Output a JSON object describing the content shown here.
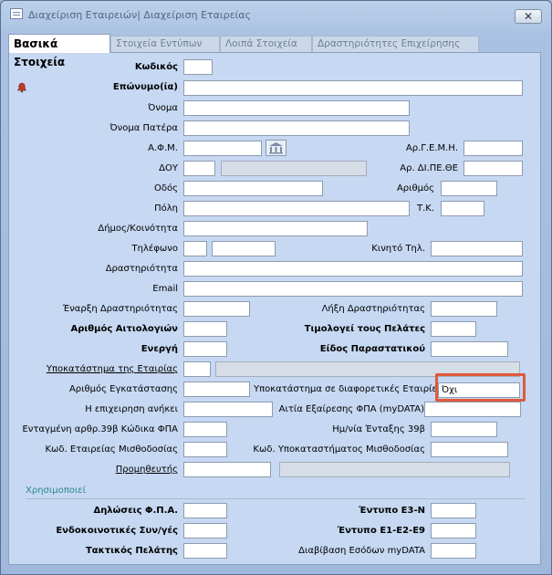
{
  "window": {
    "title": "Διαχείριση Εταιρειών| Διαχείριση Εταιρείας",
    "close_label": "✕"
  },
  "tabs": [
    {
      "label": "Βασικά Στοιχεία"
    },
    {
      "label": "Στοιχεία Εντύπων"
    },
    {
      "label": "Λοιπά Στοιχεία"
    },
    {
      "label": "Δραστηριότητες Επιχείρησης"
    }
  ],
  "labels": {
    "code": "Κωδικός",
    "surname": "Επώνυμο(ία)",
    "name": "Όνομα",
    "father": "Όνομα Πατέρα",
    "afm": "Α.Φ.Μ.",
    "gemi": "Αρ.Γ.Ε.Μ.Η.",
    "doy": "ΔΟΥ",
    "dipethe": "Αρ. ΔΙ.ΠΕ.ΘΕ",
    "street": "Οδός",
    "number": "Αριθμός",
    "city": "Πόλη",
    "tk": "Τ.Κ.",
    "municipality": "Δήμος/Κοινότητα",
    "phone": "Τηλέφωνο",
    "mobile": "Κινητό Τηλ.",
    "activity": "Δραστηριότητα",
    "email": "Email",
    "start": "Έναρξη Δραστηριότητας",
    "end": "Λήξη Δραστηριότητας",
    "ledgers": "Αριθμός Αιτιολογιών",
    "invoices": "Τιμολογεί τους Πελάτες",
    "active": "Ενεργή",
    "doc_type": "Είδος Παραστατικού",
    "branch": "Υποκατάστημα της Εταιρίας",
    "install_no": "Αριθμός Εγκατάστασης",
    "branch_other": "Υποκατάστημα σε διαφορετικές Εταιρίες",
    "belongs": "Η επιχειρηση ανήκει",
    "vat_exempt": "Αιτία Εξαίρεσης ΦΠΑ (myDATA)",
    "art39": "Ενταγμένη αρθρ.39β Κώδικα ΦΠΑ",
    "art39_date": "Ημ/νία Ένταξης 39β",
    "payroll_co": "Κωδ. Εταιρείας Μισθοδοσίας",
    "payroll_branch": "Κωδ. Υποκαταστήματος Μισθοδοσίας",
    "supplier": "Προμηθευτής",
    "uses": "Χρησιμοποιεί",
    "vat_decl": "Δηλώσεις Φ.Π.Α.",
    "e3": "Έντυπο Ε3-Ν",
    "intra": "Ενδοκοινοτικές Συν/γές",
    "e1e2e9": "Έντυπο Ε1-Ε2-Ε9",
    "regular": "Τακτικός Πελάτης",
    "mydata_income": "Διαβίβαση Εσόδων myDATA"
  },
  "values": {
    "branch_other": "Όχι"
  }
}
